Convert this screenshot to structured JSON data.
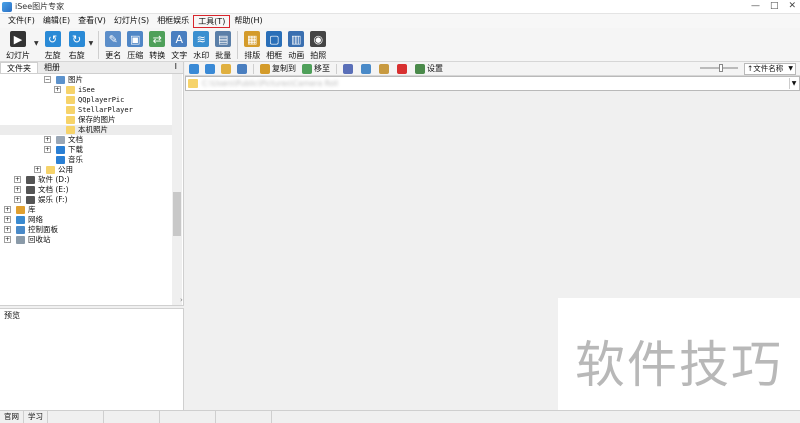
{
  "window": {
    "title": "iSee图片专家",
    "controls": [
      "—",
      "□",
      "✕"
    ]
  },
  "menu": [
    "文件(F)",
    "编辑(E)",
    "查看(V)",
    "幻灯片(S)",
    "相框娱乐",
    "工具(T)",
    "帮助(H)"
  ],
  "toolbar": {
    "buttons": [
      {
        "label": "幻灯片",
        "icon": "slideshow-icon",
        "color": "#333333"
      },
      {
        "label": "左旋",
        "icon": "rotate-left-icon",
        "color": "#2a8ad6"
      },
      {
        "label": "右旋",
        "icon": "rotate-right-icon",
        "color": "#2a8ad6"
      },
      {
        "label": "更名",
        "icon": "rename-icon",
        "color": "#5c8ec9"
      },
      {
        "label": "压缩",
        "icon": "compress-icon",
        "color": "#4f86c6"
      },
      {
        "label": "转换",
        "icon": "convert-icon",
        "color": "#4fa05a"
      },
      {
        "label": "文字",
        "icon": "text-icon",
        "color": "#4a7fc0"
      },
      {
        "label": "水印",
        "icon": "watermark-icon",
        "color": "#3a8fd0"
      },
      {
        "label": "批量",
        "icon": "batch-icon",
        "color": "#5b7fa8"
      },
      {
        "label": "排版",
        "icon": "layout-icon",
        "color": "#d49b2a"
      },
      {
        "label": "相框",
        "icon": "frame-icon",
        "color": "#2a6fb8"
      },
      {
        "label": "动画",
        "icon": "animation-icon",
        "color": "#3a6fb0"
      },
      {
        "label": "拍照",
        "icon": "camera-icon",
        "color": "#444444"
      }
    ]
  },
  "left_panel": {
    "tabs": [
      "文件夹",
      "相册"
    ],
    "pin": "I",
    "tree": [
      {
        "label": "图片",
        "indent": 4,
        "exp": "−",
        "icon": "pictures-folder-icon",
        "color": "#5c92cc"
      },
      {
        "label": "iSee",
        "indent": 5,
        "exp": "+",
        "icon": "folder-icon",
        "color": "#f6d36a",
        "mono": true
      },
      {
        "label": "QQplayerPic",
        "indent": 5,
        "exp": "",
        "icon": "folder-icon",
        "color": "#f6d36a",
        "mono": true
      },
      {
        "label": "StellarPlayer",
        "indent": 5,
        "exp": "",
        "icon": "folder-icon",
        "color": "#f6d36a",
        "mono": true
      },
      {
        "label": "保存的图片",
        "indent": 5,
        "exp": "",
        "icon": "folder-icon",
        "color": "#f6d36a"
      },
      {
        "label": "本机照片",
        "indent": 5,
        "exp": "",
        "icon": "folder-icon",
        "color": "#f6d36a",
        "selected": true
      },
      {
        "label": "文档",
        "indent": 4,
        "exp": "+",
        "icon": "documents-folder-icon",
        "color": "#9aa7b6"
      },
      {
        "label": "下载",
        "indent": 4,
        "exp": "+",
        "icon": "downloads-folder-icon",
        "color": "#2a7fd4"
      },
      {
        "label": "音乐",
        "indent": 4,
        "exp": "",
        "icon": "music-folder-icon",
        "color": "#2a7fd4"
      },
      {
        "label": "公用",
        "indent": 3,
        "exp": "+",
        "icon": "folder-icon",
        "color": "#f6d36a"
      },
      {
        "label": "软件 (D:)",
        "indent": 1,
        "exp": "+",
        "icon": "drive-icon",
        "color": "#555555"
      },
      {
        "label": "文档 (E:)",
        "indent": 1,
        "exp": "+",
        "icon": "drive-icon",
        "color": "#555555"
      },
      {
        "label": "娱乐 (F:)",
        "indent": 1,
        "exp": "+",
        "icon": "drive-icon",
        "color": "#555555"
      },
      {
        "label": "库",
        "indent": 0,
        "exp": "+",
        "icon": "library-icon",
        "color": "#e0a030"
      },
      {
        "label": "网络",
        "indent": 0,
        "exp": "+",
        "icon": "network-icon",
        "color": "#3a8ad0"
      },
      {
        "label": "控制面板",
        "indent": 0,
        "exp": "+",
        "icon": "control-panel-icon",
        "color": "#4a8ac8"
      },
      {
        "label": "回收站",
        "indent": 0,
        "exp": "+",
        "icon": "recycle-bin-icon",
        "color": "#8a9aa8"
      }
    ],
    "preview_label": "预览"
  },
  "main": {
    "nav_icons": [
      {
        "icon": "back-icon",
        "color": "#3a8ad6"
      },
      {
        "icon": "forward-icon",
        "color": "#3a8ad6"
      },
      {
        "icon": "up-folder-icon",
        "color": "#e0b040"
      },
      {
        "icon": "refresh-icon",
        "color": "#4a7fc0"
      }
    ],
    "actions": [
      {
        "label": "复制到",
        "icon": "copy-to-icon",
        "color": "#d49b2a"
      },
      {
        "label": "移至",
        "icon": "move-to-icon",
        "color": "#4fa05a"
      },
      {
        "label": "",
        "icon": "cut-icon",
        "color": "#5a6fb8"
      },
      {
        "label": "",
        "icon": "copy-icon",
        "color": "#4a8ac8"
      },
      {
        "label": "",
        "icon": "paste-icon",
        "color": "#c89a40"
      },
      {
        "label": "",
        "icon": "delete-icon",
        "color": "#d83030"
      },
      {
        "label": "设置",
        "icon": "settings-icon",
        "color": "#4a8a4a"
      }
    ],
    "sort": "↑文件名称",
    "zoom_level": 0.55,
    "path": "C:\\Users\\Public\\Pictures\\Camera Roll"
  },
  "status": [
    "官网",
    "学习"
  ],
  "watermark": "软件技巧"
}
